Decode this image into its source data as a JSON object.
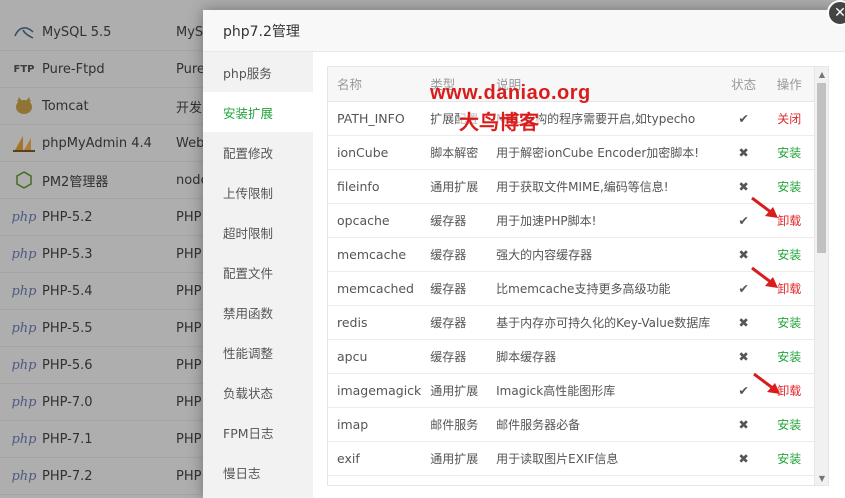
{
  "background_list": [
    {
      "icon": "mysql-icon",
      "name": "MySQL 5.5",
      "col2": "MyS"
    },
    {
      "icon": "ftp-icon",
      "icon_text": "FTP",
      "name": "Pure-Ftpd",
      "col2": "Pure"
    },
    {
      "icon": "tomcat-icon",
      "name": "Tomcat",
      "col2": "开发"
    },
    {
      "icon": "phpmyadmin-icon",
      "name": "phpMyAdmin 4.4",
      "col2": "Web"
    },
    {
      "icon": "nodejs-icon",
      "name": "PM2管理器",
      "col2": "node"
    },
    {
      "icon": "php-icon",
      "icon_text": "php",
      "name": "PHP-5.2",
      "col2": "PHP"
    },
    {
      "icon": "php-icon",
      "icon_text": "php",
      "name": "PHP-5.3",
      "col2": "PHP"
    },
    {
      "icon": "php-icon",
      "icon_text": "php",
      "name": "PHP-5.4",
      "col2": "PHP"
    },
    {
      "icon": "php-icon",
      "icon_text": "php",
      "name": "PHP-5.5",
      "col2": "PHP"
    },
    {
      "icon": "php-icon",
      "icon_text": "php",
      "name": "PHP-5.6",
      "col2": "PHP"
    },
    {
      "icon": "php-icon",
      "icon_text": "php",
      "name": "PHP-7.0",
      "col2": "PHP"
    },
    {
      "icon": "php-icon",
      "icon_text": "php",
      "name": "PHP-7.1",
      "col2": "PHP"
    },
    {
      "icon": "php-icon",
      "icon_text": "php",
      "name": "PHP-7.2",
      "col2": "PHP"
    }
  ],
  "modal": {
    "title": "php7.2管理",
    "close_icon": "close-icon",
    "sidebar": [
      {
        "label": "php服务",
        "active": false
      },
      {
        "label": "安装扩展",
        "active": true
      },
      {
        "label": "配置修改",
        "active": false
      },
      {
        "label": "上传限制",
        "active": false
      },
      {
        "label": "超时限制",
        "active": false
      },
      {
        "label": "配置文件",
        "active": false
      },
      {
        "label": "禁用函数",
        "active": false
      },
      {
        "label": "性能调整",
        "active": false
      },
      {
        "label": "负载状态",
        "active": false
      },
      {
        "label": "FPM日志",
        "active": false
      },
      {
        "label": "慢日志",
        "active": false
      }
    ],
    "table": {
      "headers": {
        "name": "名称",
        "type": "类型",
        "desc": "说明",
        "status": "状态",
        "op": "操作"
      },
      "rows": [
        {
          "name": "PATH_INFO",
          "type": "扩展配置",
          "desc": "MVC架构的程序需要开启,如typecho",
          "installed": true,
          "op": "关闭",
          "op_kind": "uninstall"
        },
        {
          "name": "ionCube",
          "type": "脚本解密",
          "desc": "用于解密ionCube Encoder加密脚本!",
          "installed": false,
          "op": "安装",
          "op_kind": "install"
        },
        {
          "name": "fileinfo",
          "type": "通用扩展",
          "desc": "用于获取文件MIME,编码等信息!",
          "installed": false,
          "op": "安装",
          "op_kind": "install"
        },
        {
          "name": "opcache",
          "type": "缓存器",
          "desc": "用于加速PHP脚本!",
          "installed": true,
          "op": "卸载",
          "op_kind": "uninstall"
        },
        {
          "name": "memcache",
          "type": "缓存器",
          "desc": "强大的内容缓存器",
          "installed": false,
          "op": "安装",
          "op_kind": "install"
        },
        {
          "name": "memcached",
          "type": "缓存器",
          "desc": "比memcache支持更多高级功能",
          "installed": true,
          "op": "卸载",
          "op_kind": "uninstall"
        },
        {
          "name": "redis",
          "type": "缓存器",
          "desc": "基于内存亦可持久化的Key-Value数据库",
          "installed": false,
          "op": "安装",
          "op_kind": "install"
        },
        {
          "name": "apcu",
          "type": "缓存器",
          "desc": "脚本缓存器",
          "installed": false,
          "op": "安装",
          "op_kind": "install"
        },
        {
          "name": "imagemagick",
          "type": "通用扩展",
          "desc": "Imagick高性能图形库",
          "installed": true,
          "op": "卸载",
          "op_kind": "uninstall"
        },
        {
          "name": "imap",
          "type": "邮件服务",
          "desc": "邮件服务器必备",
          "installed": false,
          "op": "安装",
          "op_kind": "install"
        },
        {
          "name": "exif",
          "type": "通用扩展",
          "desc": "用于读取图片EXIF信息",
          "installed": false,
          "op": "安装",
          "op_kind": "install"
        }
      ]
    }
  },
  "watermark": {
    "url": "www.daniao.org",
    "name": "大鸟博客"
  },
  "colors": {
    "install": "#20a53a",
    "uninstall": "#e0292b",
    "annotation": "#d91c1c"
  },
  "symbols": {
    "check": "✔",
    "cross": "✖"
  }
}
